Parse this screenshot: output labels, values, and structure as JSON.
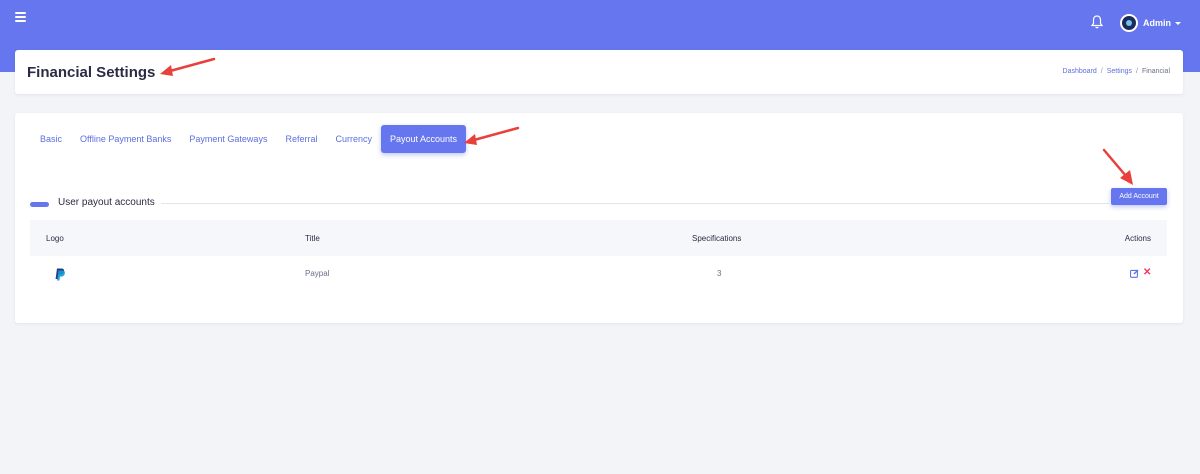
{
  "topbar": {
    "menu_icon": "hamburger-icon",
    "notification_icon": "bell-icon",
    "user_name": "Admin",
    "user_caret_icon": "caret-down-icon"
  },
  "header": {
    "title": "Financial Settings",
    "breadcrumb": [
      "Dashboard",
      "Settings",
      "Financial"
    ],
    "separator": "/"
  },
  "tabs": [
    {
      "label": "Basic",
      "active": false
    },
    {
      "label": "Offline Payment Banks",
      "active": false
    },
    {
      "label": "Payment Gateways",
      "active": false
    },
    {
      "label": "Referral",
      "active": false
    },
    {
      "label": "Currency",
      "active": false
    },
    {
      "label": "Payout Accounts",
      "active": true
    }
  ],
  "section": {
    "title": "User payout accounts",
    "add_button": "Add Account"
  },
  "table": {
    "columns": [
      "Logo",
      "Title",
      "Specifications",
      "Actions"
    ],
    "rows": [
      {
        "logo_icon": "paypal-icon",
        "title": "Paypal",
        "specifications": "3",
        "actions": [
          "edit-icon",
          "delete-icon"
        ]
      }
    ]
  },
  "colors": {
    "primary": "#6576ee",
    "danger": "#f5365c",
    "annotation_arrow": "#e8403a",
    "background": "#f3f4f8"
  }
}
